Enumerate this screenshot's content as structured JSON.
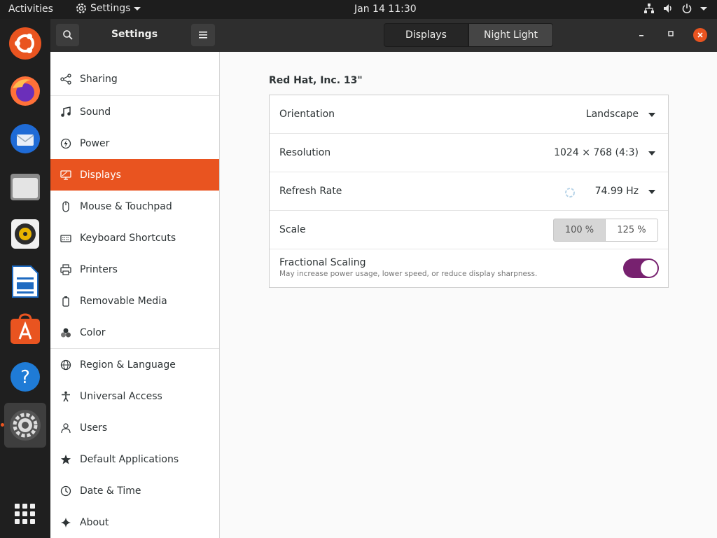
{
  "topbar": {
    "activities": "Activities",
    "app_menu": "Settings",
    "clock": "Jan 14  11:30"
  },
  "dock": {
    "items": [
      {
        "icon": "ubuntu-logo-icon"
      },
      {
        "icon": "firefox-icon"
      },
      {
        "icon": "thunderbird-icon"
      },
      {
        "icon": "files-icon"
      },
      {
        "icon": "rhythmbox-icon"
      },
      {
        "icon": "libreoffice-writer-icon"
      },
      {
        "icon": "software-center-icon"
      },
      {
        "icon": "help-icon"
      },
      {
        "icon": "settings-icon",
        "active": true
      },
      {
        "icon": "app-grid-icon"
      }
    ]
  },
  "window": {
    "title": "Settings",
    "tabs": [
      {
        "label": "Displays",
        "active": true
      },
      {
        "label": "Night Light",
        "active": false
      }
    ]
  },
  "sidebar": {
    "items": [
      {
        "label": "Sharing",
        "icon": "share-icon"
      },
      {
        "label": "Sound",
        "icon": "music-note-icon"
      },
      {
        "label": "Power",
        "icon": "power-icon"
      },
      {
        "label": "Displays",
        "icon": "display-icon",
        "selected": true
      },
      {
        "label": "Mouse & Touchpad",
        "icon": "mouse-icon"
      },
      {
        "label": "Keyboard Shortcuts",
        "icon": "keyboard-icon"
      },
      {
        "label": "Printers",
        "icon": "printer-icon"
      },
      {
        "label": "Removable Media",
        "icon": "usb-drive-icon"
      },
      {
        "label": "Color",
        "icon": "color-icon"
      },
      {
        "label": "Region & Language",
        "icon": "globe-icon"
      },
      {
        "label": "Universal Access",
        "icon": "accessibility-icon"
      },
      {
        "label": "Users",
        "icon": "users-icon"
      },
      {
        "label": "Default Applications",
        "icon": "star-icon"
      },
      {
        "label": "Date & Time",
        "icon": "clock-icon"
      },
      {
        "label": "About",
        "icon": "sparkle-icon"
      }
    ]
  },
  "display": {
    "monitor_name": "Red Hat, Inc. 13\"",
    "orientation": {
      "label": "Orientation",
      "value": "Landscape"
    },
    "resolution": {
      "label": "Resolution",
      "value": "1024 × 768 (4:3)"
    },
    "refresh_rate": {
      "label": "Refresh Rate",
      "value": "74.99 Hz"
    },
    "scale": {
      "label": "Scale",
      "options": [
        "100 %",
        "125 %"
      ],
      "selected": "100 %"
    },
    "fractional_scaling": {
      "label": "Fractional Scaling",
      "description": "May increase power usage, lower speed, or reduce display sharpness.",
      "enabled": true
    }
  },
  "colors": {
    "accent": "#e95420",
    "toggle_on": "#77216f",
    "headerbar": "#2e2e2e"
  }
}
